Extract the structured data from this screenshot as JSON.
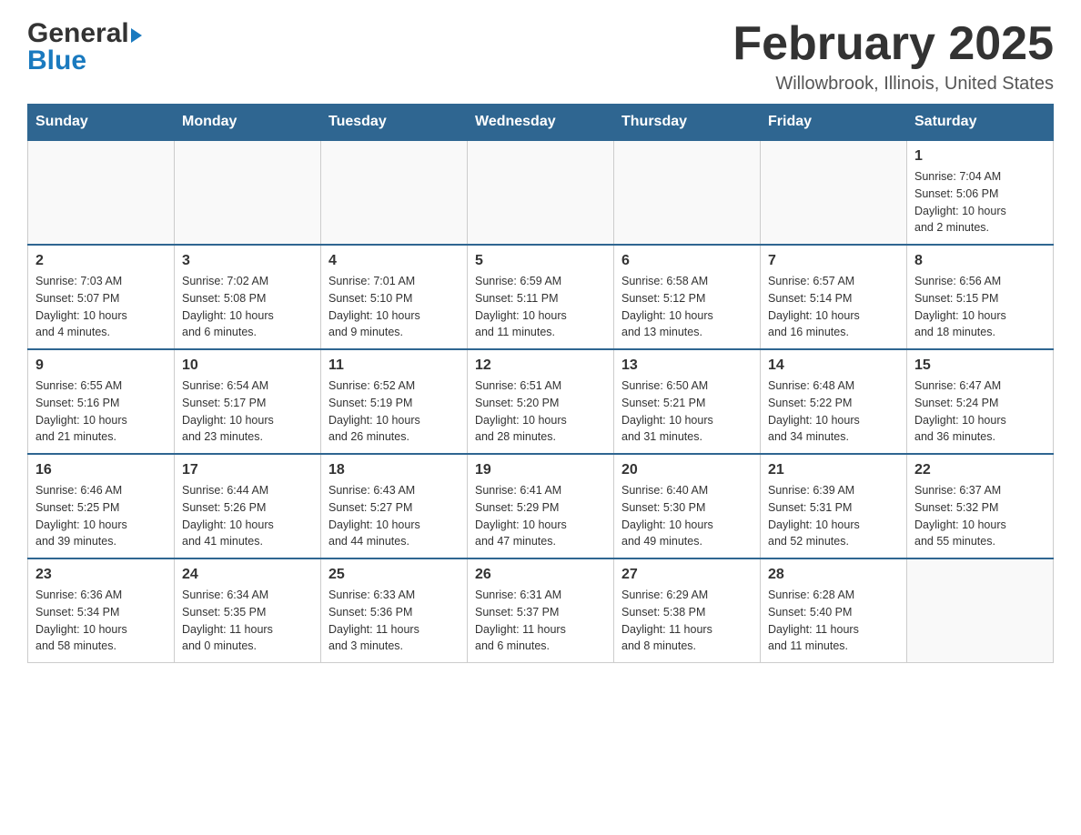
{
  "header": {
    "logo_general": "General",
    "logo_blue": "Blue",
    "month_title": "February 2025",
    "location": "Willowbrook, Illinois, United States"
  },
  "days_of_week": [
    "Sunday",
    "Monday",
    "Tuesday",
    "Wednesday",
    "Thursday",
    "Friday",
    "Saturday"
  ],
  "weeks": [
    {
      "days": [
        {
          "num": "",
          "info": ""
        },
        {
          "num": "",
          "info": ""
        },
        {
          "num": "",
          "info": ""
        },
        {
          "num": "",
          "info": ""
        },
        {
          "num": "",
          "info": ""
        },
        {
          "num": "",
          "info": ""
        },
        {
          "num": "1",
          "info": "Sunrise: 7:04 AM\nSunset: 5:06 PM\nDaylight: 10 hours\nand 2 minutes."
        }
      ]
    },
    {
      "days": [
        {
          "num": "2",
          "info": "Sunrise: 7:03 AM\nSunset: 5:07 PM\nDaylight: 10 hours\nand 4 minutes."
        },
        {
          "num": "3",
          "info": "Sunrise: 7:02 AM\nSunset: 5:08 PM\nDaylight: 10 hours\nand 6 minutes."
        },
        {
          "num": "4",
          "info": "Sunrise: 7:01 AM\nSunset: 5:10 PM\nDaylight: 10 hours\nand 9 minutes."
        },
        {
          "num": "5",
          "info": "Sunrise: 6:59 AM\nSunset: 5:11 PM\nDaylight: 10 hours\nand 11 minutes."
        },
        {
          "num": "6",
          "info": "Sunrise: 6:58 AM\nSunset: 5:12 PM\nDaylight: 10 hours\nand 13 minutes."
        },
        {
          "num": "7",
          "info": "Sunrise: 6:57 AM\nSunset: 5:14 PM\nDaylight: 10 hours\nand 16 minutes."
        },
        {
          "num": "8",
          "info": "Sunrise: 6:56 AM\nSunset: 5:15 PM\nDaylight: 10 hours\nand 18 minutes."
        }
      ]
    },
    {
      "days": [
        {
          "num": "9",
          "info": "Sunrise: 6:55 AM\nSunset: 5:16 PM\nDaylight: 10 hours\nand 21 minutes."
        },
        {
          "num": "10",
          "info": "Sunrise: 6:54 AM\nSunset: 5:17 PM\nDaylight: 10 hours\nand 23 minutes."
        },
        {
          "num": "11",
          "info": "Sunrise: 6:52 AM\nSunset: 5:19 PM\nDaylight: 10 hours\nand 26 minutes."
        },
        {
          "num": "12",
          "info": "Sunrise: 6:51 AM\nSunset: 5:20 PM\nDaylight: 10 hours\nand 28 minutes."
        },
        {
          "num": "13",
          "info": "Sunrise: 6:50 AM\nSunset: 5:21 PM\nDaylight: 10 hours\nand 31 minutes."
        },
        {
          "num": "14",
          "info": "Sunrise: 6:48 AM\nSunset: 5:22 PM\nDaylight: 10 hours\nand 34 minutes."
        },
        {
          "num": "15",
          "info": "Sunrise: 6:47 AM\nSunset: 5:24 PM\nDaylight: 10 hours\nand 36 minutes."
        }
      ]
    },
    {
      "days": [
        {
          "num": "16",
          "info": "Sunrise: 6:46 AM\nSunset: 5:25 PM\nDaylight: 10 hours\nand 39 minutes."
        },
        {
          "num": "17",
          "info": "Sunrise: 6:44 AM\nSunset: 5:26 PM\nDaylight: 10 hours\nand 41 minutes."
        },
        {
          "num": "18",
          "info": "Sunrise: 6:43 AM\nSunset: 5:27 PM\nDaylight: 10 hours\nand 44 minutes."
        },
        {
          "num": "19",
          "info": "Sunrise: 6:41 AM\nSunset: 5:29 PM\nDaylight: 10 hours\nand 47 minutes."
        },
        {
          "num": "20",
          "info": "Sunrise: 6:40 AM\nSunset: 5:30 PM\nDaylight: 10 hours\nand 49 minutes."
        },
        {
          "num": "21",
          "info": "Sunrise: 6:39 AM\nSunset: 5:31 PM\nDaylight: 10 hours\nand 52 minutes."
        },
        {
          "num": "22",
          "info": "Sunrise: 6:37 AM\nSunset: 5:32 PM\nDaylight: 10 hours\nand 55 minutes."
        }
      ]
    },
    {
      "days": [
        {
          "num": "23",
          "info": "Sunrise: 6:36 AM\nSunset: 5:34 PM\nDaylight: 10 hours\nand 58 minutes."
        },
        {
          "num": "24",
          "info": "Sunrise: 6:34 AM\nSunset: 5:35 PM\nDaylight: 11 hours\nand 0 minutes."
        },
        {
          "num": "25",
          "info": "Sunrise: 6:33 AM\nSunset: 5:36 PM\nDaylight: 11 hours\nand 3 minutes."
        },
        {
          "num": "26",
          "info": "Sunrise: 6:31 AM\nSunset: 5:37 PM\nDaylight: 11 hours\nand 6 minutes."
        },
        {
          "num": "27",
          "info": "Sunrise: 6:29 AM\nSunset: 5:38 PM\nDaylight: 11 hours\nand 8 minutes."
        },
        {
          "num": "28",
          "info": "Sunrise: 6:28 AM\nSunset: 5:40 PM\nDaylight: 11 hours\nand 11 minutes."
        },
        {
          "num": "",
          "info": ""
        }
      ]
    }
  ],
  "colors": {
    "header_bg": "#2f6691",
    "header_text": "#ffffff",
    "border": "#cccccc",
    "accent_blue": "#1a7abf"
  }
}
